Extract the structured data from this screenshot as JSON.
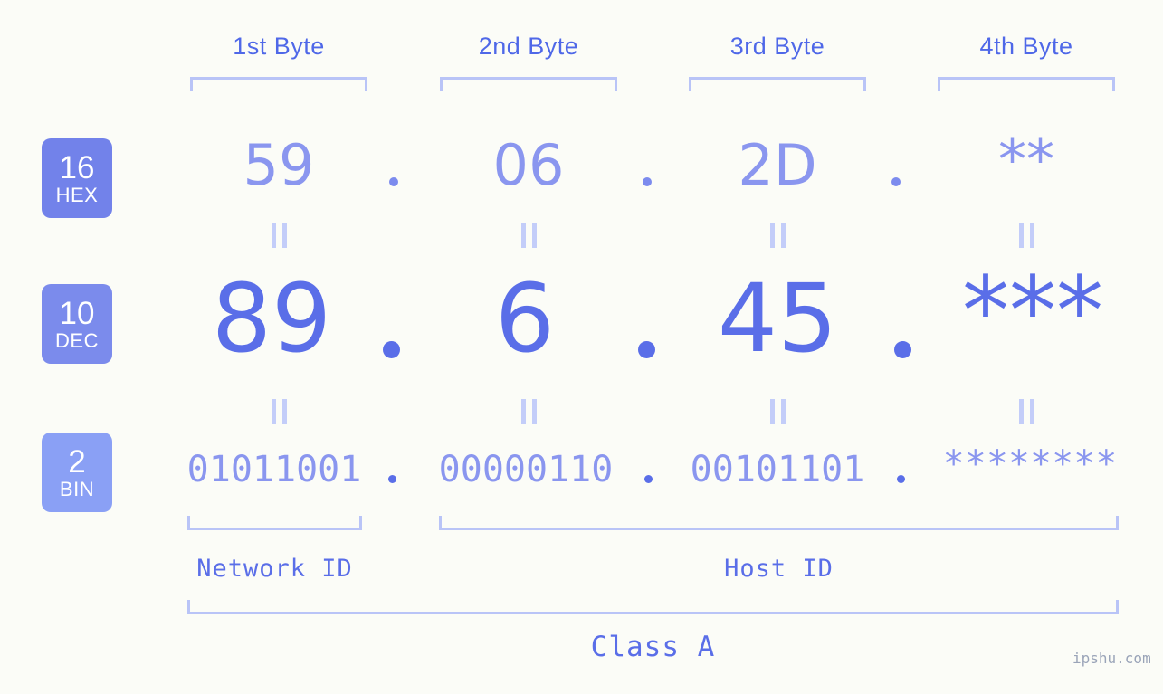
{
  "page": {
    "background_color": "#fbfcf7",
    "watermark": "ipshu.com"
  },
  "byte_headers": [
    {
      "label": "1st Byte"
    },
    {
      "label": "2nd Byte"
    },
    {
      "label": "3rd Byte"
    },
    {
      "label": "4th Byte"
    }
  ],
  "radix_rows": [
    {
      "badge_number": "16",
      "badge_radix": "HEX",
      "badge_color": "#7282ea",
      "text_color": "#8a96ef",
      "values": [
        "59",
        "06",
        "2D",
        "**"
      ]
    },
    {
      "badge_number": "10",
      "badge_radix": "DEC",
      "badge_color": "#7b8bec",
      "text_color": "#5a6ee8",
      "values": [
        "89",
        "6",
        "45",
        "***"
      ]
    },
    {
      "badge_number": "2",
      "badge_radix": "BIN",
      "badge_color": "#8aa0f5",
      "text_color": "#8a96ef",
      "values": [
        "01011001",
        "00000110",
        "00101101",
        "********"
      ]
    }
  ],
  "separator": {
    "dot": ".",
    "equals": "‖"
  },
  "segments": {
    "network_id_label": "Network ID",
    "host_id_label": "Host ID",
    "class_label": "Class A"
  },
  "colors": {
    "accent": "#5a6ee8",
    "accent_light": "#8a96ef",
    "bracket": "#b9c4f7",
    "header": "#4f68e8"
  }
}
